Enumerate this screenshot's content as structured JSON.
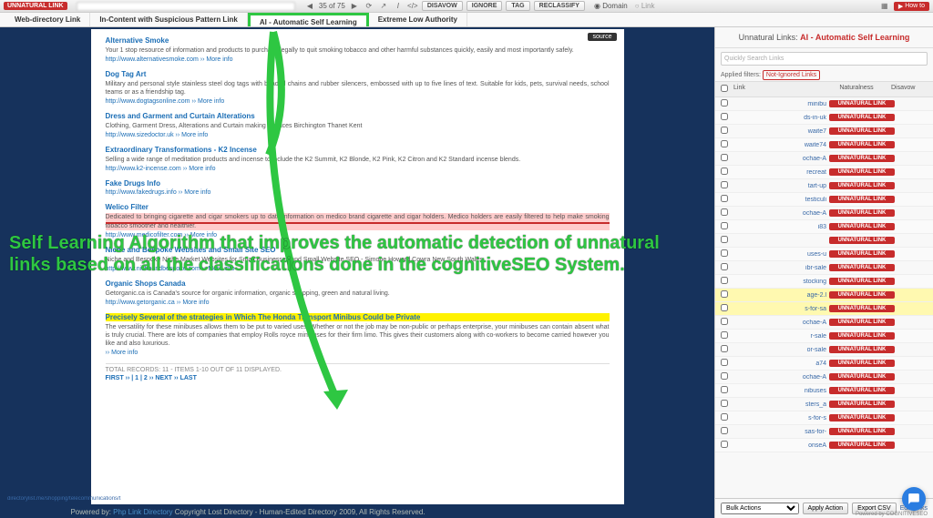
{
  "topbar": {
    "badge": "UNNATURAL LINK",
    "pager": "35 of 75",
    "buttons": {
      "disavow": "DISAVOW",
      "ignore": "IGNORE",
      "tag": "TAG",
      "reclassify": "RECLASSIFY"
    },
    "domain": "Domain",
    "link": "Link",
    "howto": "How to"
  },
  "tabs": [
    "Web-directory Link",
    "In-Content with Suspicious Pattern Link",
    "AI - Automatic Self Learning",
    "Extreme Low Authority"
  ],
  "overlay": "Self Learning Algorithm that improves the automatic detection of unnatural links based on all the classifications done in the cognitiveSEO System.",
  "page": {
    "source": "source",
    "entries": [
      {
        "title": "Alternative Smoke",
        "desc": "Your 1 stop resource of information and products to purchase legally to quit smoking tobacco and other harmful substances quickly, easily and most importantly safely.",
        "url": "http://www.alternativesmoke.com ›› More info"
      },
      {
        "title": "Dog Tag Art",
        "desc": "Military and personal style stainless steel dog tags with beaded chains and rubber silencers, embossed with up to five lines of text. Suitable for kids, pets, survival needs, school teams or as a friendship tag.",
        "url": "http://www.dogtagsonline.com ›› More info"
      },
      {
        "title": "Dress and Garment and Curtain Alterations",
        "desc": "Clothing, Garment Dress, Alterations and Curtain making Services Birchington Thanet Kent",
        "url": "http://www.sizedoctor.uk ›› More info"
      },
      {
        "title": "Extraordinary Transformations - K2 Incense",
        "desc": "Selling a wide range of meditation products and incense to include the K2 Summit, K2 Blonde, K2 Pink, K2 Citron and K2 Standard incense blends.",
        "url": "http://www.k2-incense.com ›› More info"
      },
      {
        "title": "Fake Drugs Info",
        "desc": "",
        "url": "http://www.fakedrugs.info ›› More info"
      },
      {
        "title": "Welico Filter",
        "desc": "Dedicated to bringing cigarette and cigar smokers up to date information on medico brand cigarette and cigar holders. Medico holders are easily filtered to help make smoking tobacco smoother and healthier.",
        "url": "http://www.medicofilter.com ›› More info"
      },
      {
        "title": "Niche and Bespoke Websites and Small Site SEO",
        "desc": "Niche and Bespoke Niche Market Websites for Small Businesses and Small Website SEO - Simone Howard Cowra New South Wales",
        "url": "http://www.nicheandbespoke.com ›› More info"
      },
      {
        "title": "Organic Shops Canada",
        "desc": "Getorganic.ca is Canada's source for organic information, organic shopping, green and natural living.",
        "url": "http://www.getorganic.ca ›› More info"
      },
      {
        "title": "Precisely Several of the strategies in Which The Honda Transport Minibus Could be Private",
        "desc": "The versatility for these minibuses allows them to be put to varied uses. Whether or not the job may be non-public or perhaps enterprise, your minibuses can contain absent what is truly crucial. There are lots of companies that employ Rolls royce minibuses for their firm limo. This gives their customers along with co-workers to become carried however you like and also luxurious.",
        "url": " ›› More info"
      }
    ],
    "totals": "TOTAL RECORDS: 11 - ITEMS 1-10 OUT OF 11 DISPLAYED.",
    "pagenav": "FIRST ›› | 1 | 2 ›› NEXT ›› LAST"
  },
  "footer": {
    "pre": "Powered by: ",
    "link": "Php Link Directory",
    "post": " Copyright Lost Directory - Human-Edited Directory 2009, All Rights Reserved."
  },
  "sidebar": {
    "head_pre": "Unnatural Links: ",
    "head_red": "AI - Automatic Self Learning",
    "search_placeholder": "Quickly Search Links",
    "filters_label": "Applied filters: ",
    "filters_tag": "Not-Ignored Links",
    "cols": {
      "link": "Link",
      "nat": "Naturalness",
      "dis": "Disavow"
    },
    "rows": [
      {
        "t": "minibu",
        "hl": false
      },
      {
        "t": "ds-in-uk",
        "hl": false
      },
      {
        "t": "waite7",
        "hl": false
      },
      {
        "t": "waite74",
        "hl": false
      },
      {
        "t": "ochae-A",
        "hl": false
      },
      {
        "t": "recreat",
        "hl": false
      },
      {
        "t": "tart-up",
        "hl": false
      },
      {
        "t": "testiculi",
        "hl": false
      },
      {
        "t": "ochae-A",
        "hl": false
      },
      {
        "t": "i83",
        "hl": false
      },
      {
        "t": "",
        "hl": false
      },
      {
        "t": "uses-u",
        "hl": false
      },
      {
        "t": "ibr-sale",
        "hl": false
      },
      {
        "t": "stocking",
        "hl": false
      },
      {
        "t": "age-2.l",
        "hl": true
      },
      {
        "t": "s-for-sa",
        "hl": true
      },
      {
        "t": "ochae-A",
        "hl": false
      },
      {
        "t": "r-sale",
        "hl": false
      },
      {
        "t": "or-sale",
        "hl": false
      },
      {
        "t": "a74",
        "hl": false
      },
      {
        "t": "ochae-A",
        "hl": false
      },
      {
        "t": "nibuses",
        "hl": false
      },
      {
        "t": "sters_a",
        "hl": false
      },
      {
        "t": "s-for-s",
        "hl": false
      },
      {
        "t": "sas-for-",
        "hl": false
      },
      {
        "t": "onseA",
        "hl": false
      }
    ],
    "unnat": "UNNATURAL LINK",
    "long_url": "directorylist.me/shopping/telecommunications/t",
    "bulk": "Bulk Actions",
    "apply": "Apply Action",
    "export": "Export CSV",
    "edit": "Edit Links",
    "powered": "Powered by COGNITIVESEO"
  }
}
